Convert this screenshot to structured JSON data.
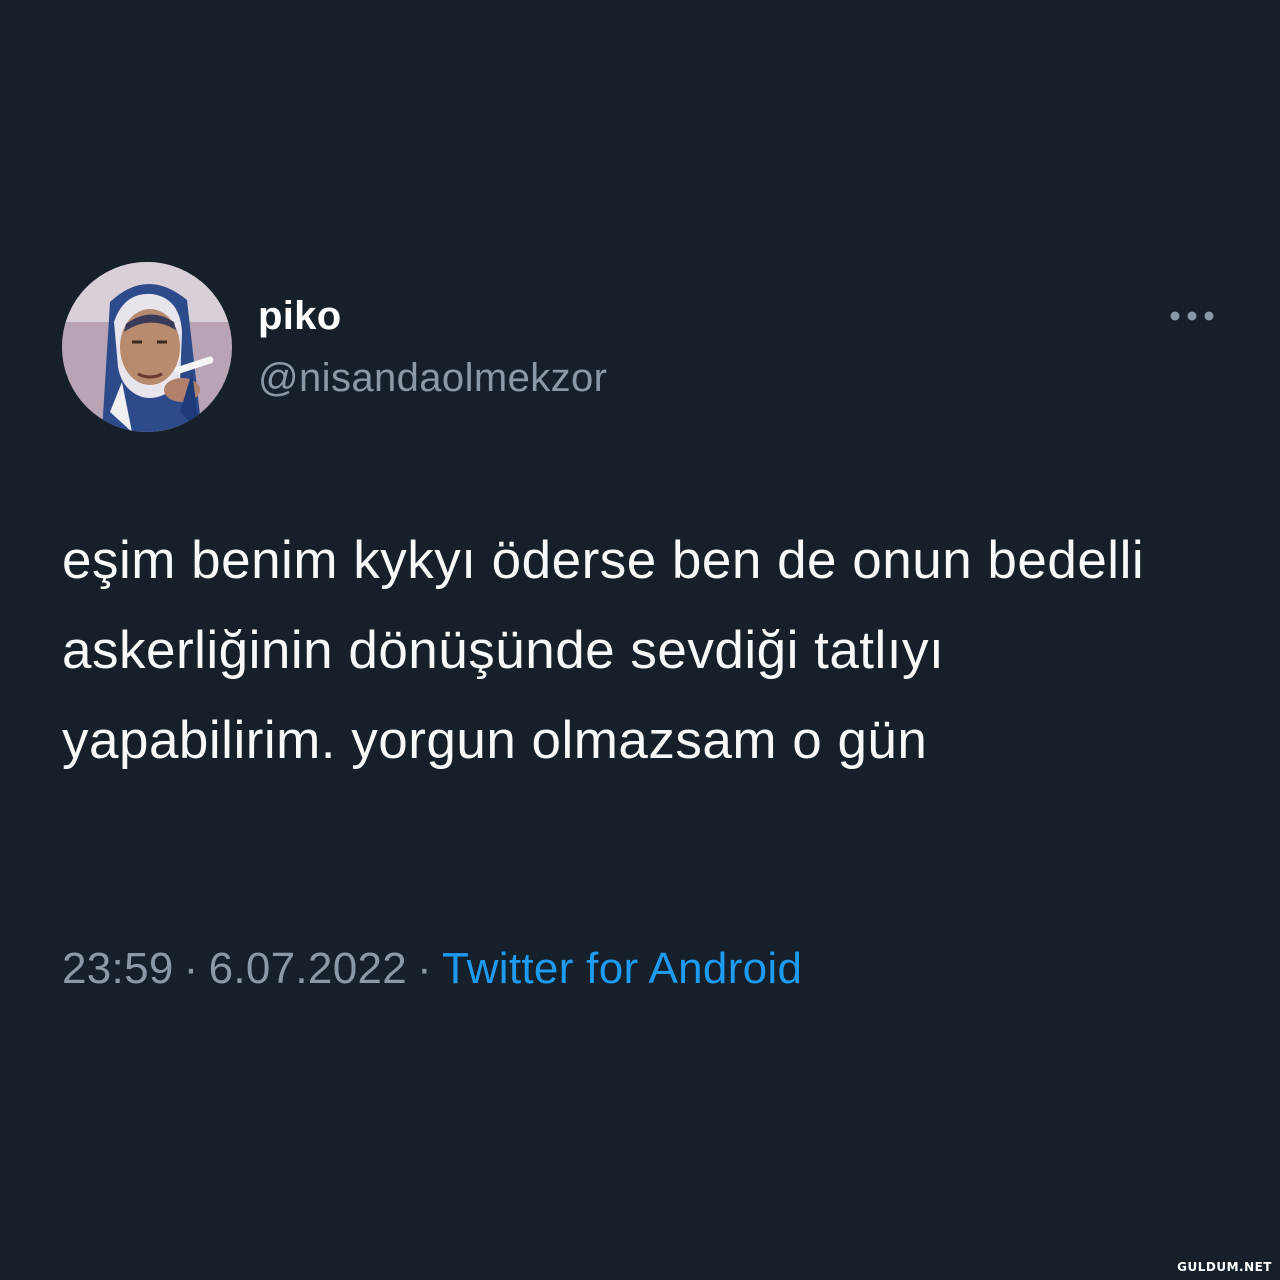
{
  "tweet": {
    "display_name": "piko",
    "handle": "@nisandaolmekzor",
    "avatar_icon": "profile-photo",
    "more_icon": "more-horizontal-icon",
    "text": "eşim benim kykyı öderse ben de onun bedelli askerliğinin dönüşünde sevdiği tatlıyı yapabilirim. yorgun olmazsam o gün",
    "time": "23:59",
    "separator": "·",
    "date": "6.07.2022",
    "source": "Twitter for Android"
  },
  "watermark": "GULDUM.NET",
  "colors": {
    "background": "#15202b",
    "text": "#f7f9f9",
    "secondary": "#8b98a5",
    "link": "#1d9bf0"
  }
}
